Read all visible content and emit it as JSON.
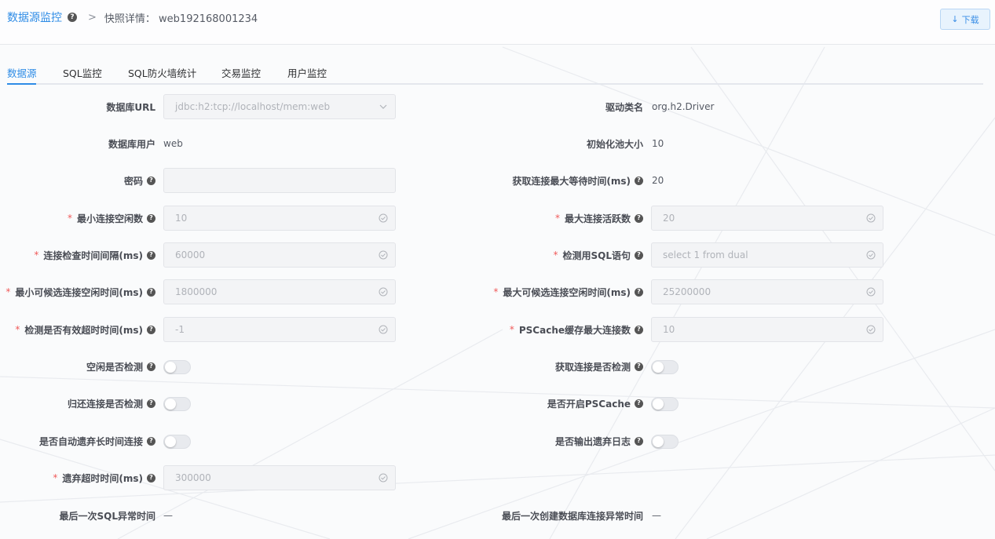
{
  "breadcrumb": {
    "root": "数据源监控",
    "current": "快照详情： web192168001234"
  },
  "download_label": "下载",
  "tabs": [
    "数据源",
    "SQL监控",
    "SQL防火墙统计",
    "交易监控",
    "用户监控"
  ],
  "active_tab": "数据源",
  "form": {
    "db_url": {
      "label": "数据库URL",
      "value": "jdbc:h2:tcp://localhost/mem:web"
    },
    "driver": {
      "label": "驱动类名",
      "value": "org.h2.Driver"
    },
    "db_user": {
      "label": "数据库用户",
      "value": "web"
    },
    "init_pool": {
      "label": "初始化池大小",
      "value": "10"
    },
    "password": {
      "label": "密码",
      "value": ""
    },
    "max_wait": {
      "label": "获取连接最大等待时间(ms)",
      "value": "20"
    },
    "min_idle": {
      "label": "最小连接空闲数",
      "value": "10"
    },
    "max_active": {
      "label": "最大连接活跃数",
      "value": "20"
    },
    "check_interval": {
      "label": "连接检查时间间隔(ms)",
      "value": "60000"
    },
    "validation_sql": {
      "label": "检测用SQL语句",
      "value": "select 1 from dual"
    },
    "min_evictable": {
      "label": "最小可候选连接空闲时间(ms)",
      "value": "1800000"
    },
    "max_evictable": {
      "label": "最大可候选连接空闲时间(ms)",
      "value": "25200000"
    },
    "valid_timeout": {
      "label": "检测是否有效超时时间(ms)",
      "value": "-1"
    },
    "ps_cache_max": {
      "label": "PSCache缓存最大连接数",
      "value": "10"
    },
    "test_idle": {
      "label": "空闲是否检测",
      "on": false
    },
    "test_borrow": {
      "label": "获取连接是否检测",
      "on": false
    },
    "test_return": {
      "label": "归还连接是否检测",
      "on": false
    },
    "ps_cache": {
      "label": "是否开启PSCache",
      "on": false
    },
    "remove_abandoned": {
      "label": "是否自动遗弃长时间连接",
      "on": false
    },
    "log_abandoned": {
      "label": "是否输出遗弃日志",
      "on": false
    },
    "abandon_timeout": {
      "label": "遗弃超时时间(ms)",
      "value": "300000"
    },
    "last_sql_error": {
      "label": "最后一次SQL异常时间",
      "value": "—"
    },
    "last_create_error": {
      "label": "最后一次创建数据库连接异常时间",
      "value": "—"
    }
  },
  "colors": {
    "accent": "#2e8ce6",
    "required": "#f05a5a"
  }
}
